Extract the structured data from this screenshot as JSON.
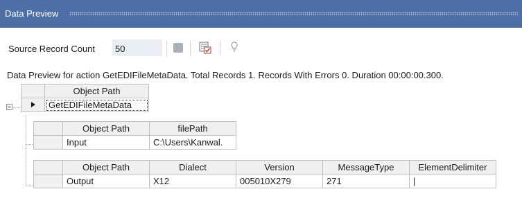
{
  "window": {
    "title": "Data Preview"
  },
  "toolbar": {
    "source_record_count_label": "Source Record Count",
    "source_record_count_value": "50",
    "icons": [
      "stop-icon",
      "preview-icon",
      "lightbulb-icon"
    ]
  },
  "status_text": "Data Preview for action GetEDIFileMetaData. Total Records 1. Records With Errors 0. Duration 00:00:00.300.",
  "root_grid": {
    "header": "Object Path",
    "row": "GetEDIFileMetaData"
  },
  "input_grid": {
    "headers": [
      "Object Path",
      "filePath"
    ],
    "row": [
      "Input",
      "C:\\Users\\Kanwal."
    ]
  },
  "output_grid": {
    "headers": [
      "Object Path",
      "Dialect",
      "Version",
      "MessageType",
      "ElementDelimiter"
    ],
    "row": [
      "Output",
      "X12",
      "005010X279",
      "271",
      "|"
    ]
  },
  "colors": {
    "titlebar": "#4e6fa6",
    "input_bg": "#e9edf3",
    "grid_header": "#f0f0f0"
  }
}
